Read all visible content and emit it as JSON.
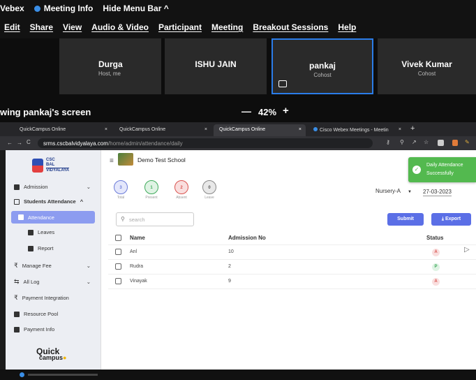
{
  "webex": {
    "app_name": "Vebex",
    "meeting_info": "Meeting Info",
    "hide_menu_bar": "Hide Menu Bar",
    "caret": "^",
    "menu": [
      "Edit",
      "Share",
      "View",
      "Audio & Video",
      "Participant",
      "Meeting",
      "Breakout Sessions",
      "Help"
    ]
  },
  "participants": [
    {
      "name": "Durga",
      "role": "Host, me"
    },
    {
      "name": "ISHU JAIN",
      "role": ""
    },
    {
      "name": "pankaj",
      "role": "Cohost"
    },
    {
      "name": "Vivek Kumar",
      "role": "Cohost"
    }
  ],
  "share": {
    "label": "wing pankaj's screen",
    "zoom_minus": "—",
    "zoom": "42%",
    "zoom_plus": "+"
  },
  "browser": {
    "tabs": [
      {
        "title": "QuickCampus Online",
        "close": "×"
      },
      {
        "title": "QuickCampus Online",
        "close": "×"
      },
      {
        "title": "QuickCampus Online",
        "close": "×"
      },
      {
        "title": "Cisco Webex Meetings - Meetin",
        "close": "×"
      }
    ],
    "new_tab": "+",
    "url_host": "srms.cscbalvidyalaya.com",
    "url_path": "/home/admin/attendance/daily"
  },
  "app": {
    "logo_line1": "CSC",
    "logo_line2": "BAL",
    "logo_line3": "VIDYALAYA",
    "school_name": "Demo Test School",
    "footer_logo_1": "Quick",
    "footer_logo_2": "campus",
    "sidebar": [
      {
        "label": "Admission",
        "chevron": "⌄"
      },
      {
        "label": "Students Attendance",
        "chevron": "^"
      },
      {
        "label": "Attendance",
        "chevron": ""
      },
      {
        "label": "Leaves",
        "chevron": ""
      },
      {
        "label": "Report",
        "chevron": ""
      },
      {
        "label": "Manage Fee",
        "chevron": "⌄"
      },
      {
        "label": "All Log",
        "chevron": "⌄"
      },
      {
        "label": "Payment Integration",
        "chevron": ""
      },
      {
        "label": "Resource Pool",
        "chevron": ""
      },
      {
        "label": "Payment Info",
        "chevron": ""
      }
    ],
    "stats": [
      {
        "value": "3",
        "label": "Total",
        "color": "#6b7bd8",
        "bg": "#e4e7fb"
      },
      {
        "value": "1",
        "label": "Present",
        "color": "#3faa5b",
        "bg": "#dff3e4"
      },
      {
        "value": "2",
        "label": "Absent",
        "color": "#d9534f",
        "bg": "#f9dede"
      },
      {
        "value": "0",
        "label": "Leave",
        "color": "#555",
        "bg": "#e8e8e8"
      }
    ],
    "class_select": "Nursery-A",
    "date": "27-03-2023",
    "search_placeholder": "search",
    "submit_label": "Submit",
    "export_label": "Export",
    "table_headers": [
      "Name",
      "Admission No",
      "Status"
    ],
    "rows": [
      {
        "name": "Anl",
        "admission_no": "10",
        "status": "A"
      },
      {
        "name": "Rudra",
        "admission_no": "2",
        "status": "P"
      },
      {
        "name": "Vinayak",
        "admission_no": "9",
        "status": "A"
      }
    ],
    "toast_line1": "Daily Attendance",
    "toast_line2": "Successfully"
  },
  "colors": {
    "accent": "#5b6fe6",
    "present": "#3faa5b",
    "absent": "#d9534f",
    "toast": "#53b94f",
    "active_menu": "#8c9cf0"
  }
}
